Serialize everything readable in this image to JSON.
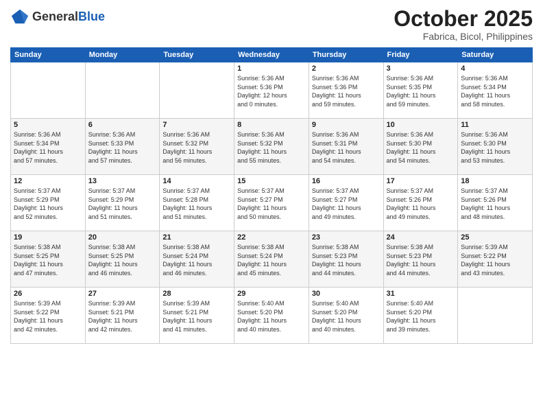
{
  "logo": {
    "general": "General",
    "blue": "Blue"
  },
  "header": {
    "month": "October 2025",
    "location": "Fabrica, Bicol, Philippines"
  },
  "weekdays": [
    "Sunday",
    "Monday",
    "Tuesday",
    "Wednesday",
    "Thursday",
    "Friday",
    "Saturday"
  ],
  "weeks": [
    [
      {
        "day": "",
        "info": ""
      },
      {
        "day": "",
        "info": ""
      },
      {
        "day": "",
        "info": ""
      },
      {
        "day": "1",
        "info": "Sunrise: 5:36 AM\nSunset: 5:36 PM\nDaylight: 12 hours\nand 0 minutes."
      },
      {
        "day": "2",
        "info": "Sunrise: 5:36 AM\nSunset: 5:36 PM\nDaylight: 11 hours\nand 59 minutes."
      },
      {
        "day": "3",
        "info": "Sunrise: 5:36 AM\nSunset: 5:35 PM\nDaylight: 11 hours\nand 59 minutes."
      },
      {
        "day": "4",
        "info": "Sunrise: 5:36 AM\nSunset: 5:34 PM\nDaylight: 11 hours\nand 58 minutes."
      }
    ],
    [
      {
        "day": "5",
        "info": "Sunrise: 5:36 AM\nSunset: 5:34 PM\nDaylight: 11 hours\nand 57 minutes."
      },
      {
        "day": "6",
        "info": "Sunrise: 5:36 AM\nSunset: 5:33 PM\nDaylight: 11 hours\nand 57 minutes."
      },
      {
        "day": "7",
        "info": "Sunrise: 5:36 AM\nSunset: 5:32 PM\nDaylight: 11 hours\nand 56 minutes."
      },
      {
        "day": "8",
        "info": "Sunrise: 5:36 AM\nSunset: 5:32 PM\nDaylight: 11 hours\nand 55 minutes."
      },
      {
        "day": "9",
        "info": "Sunrise: 5:36 AM\nSunset: 5:31 PM\nDaylight: 11 hours\nand 54 minutes."
      },
      {
        "day": "10",
        "info": "Sunrise: 5:36 AM\nSunset: 5:30 PM\nDaylight: 11 hours\nand 54 minutes."
      },
      {
        "day": "11",
        "info": "Sunrise: 5:36 AM\nSunset: 5:30 PM\nDaylight: 11 hours\nand 53 minutes."
      }
    ],
    [
      {
        "day": "12",
        "info": "Sunrise: 5:37 AM\nSunset: 5:29 PM\nDaylight: 11 hours\nand 52 minutes."
      },
      {
        "day": "13",
        "info": "Sunrise: 5:37 AM\nSunset: 5:29 PM\nDaylight: 11 hours\nand 51 minutes."
      },
      {
        "day": "14",
        "info": "Sunrise: 5:37 AM\nSunset: 5:28 PM\nDaylight: 11 hours\nand 51 minutes."
      },
      {
        "day": "15",
        "info": "Sunrise: 5:37 AM\nSunset: 5:27 PM\nDaylight: 11 hours\nand 50 minutes."
      },
      {
        "day": "16",
        "info": "Sunrise: 5:37 AM\nSunset: 5:27 PM\nDaylight: 11 hours\nand 49 minutes."
      },
      {
        "day": "17",
        "info": "Sunrise: 5:37 AM\nSunset: 5:26 PM\nDaylight: 11 hours\nand 49 minutes."
      },
      {
        "day": "18",
        "info": "Sunrise: 5:37 AM\nSunset: 5:26 PM\nDaylight: 11 hours\nand 48 minutes."
      }
    ],
    [
      {
        "day": "19",
        "info": "Sunrise: 5:38 AM\nSunset: 5:25 PM\nDaylight: 11 hours\nand 47 minutes."
      },
      {
        "day": "20",
        "info": "Sunrise: 5:38 AM\nSunset: 5:25 PM\nDaylight: 11 hours\nand 46 minutes."
      },
      {
        "day": "21",
        "info": "Sunrise: 5:38 AM\nSunset: 5:24 PM\nDaylight: 11 hours\nand 46 minutes."
      },
      {
        "day": "22",
        "info": "Sunrise: 5:38 AM\nSunset: 5:24 PM\nDaylight: 11 hours\nand 45 minutes."
      },
      {
        "day": "23",
        "info": "Sunrise: 5:38 AM\nSunset: 5:23 PM\nDaylight: 11 hours\nand 44 minutes."
      },
      {
        "day": "24",
        "info": "Sunrise: 5:38 AM\nSunset: 5:23 PM\nDaylight: 11 hours\nand 44 minutes."
      },
      {
        "day": "25",
        "info": "Sunrise: 5:39 AM\nSunset: 5:22 PM\nDaylight: 11 hours\nand 43 minutes."
      }
    ],
    [
      {
        "day": "26",
        "info": "Sunrise: 5:39 AM\nSunset: 5:22 PM\nDaylight: 11 hours\nand 42 minutes."
      },
      {
        "day": "27",
        "info": "Sunrise: 5:39 AM\nSunset: 5:21 PM\nDaylight: 11 hours\nand 42 minutes."
      },
      {
        "day": "28",
        "info": "Sunrise: 5:39 AM\nSunset: 5:21 PM\nDaylight: 11 hours\nand 41 minutes."
      },
      {
        "day": "29",
        "info": "Sunrise: 5:40 AM\nSunset: 5:20 PM\nDaylight: 11 hours\nand 40 minutes."
      },
      {
        "day": "30",
        "info": "Sunrise: 5:40 AM\nSunset: 5:20 PM\nDaylight: 11 hours\nand 40 minutes."
      },
      {
        "day": "31",
        "info": "Sunrise: 5:40 AM\nSunset: 5:20 PM\nDaylight: 11 hours\nand 39 minutes."
      },
      {
        "day": "",
        "info": ""
      }
    ]
  ]
}
